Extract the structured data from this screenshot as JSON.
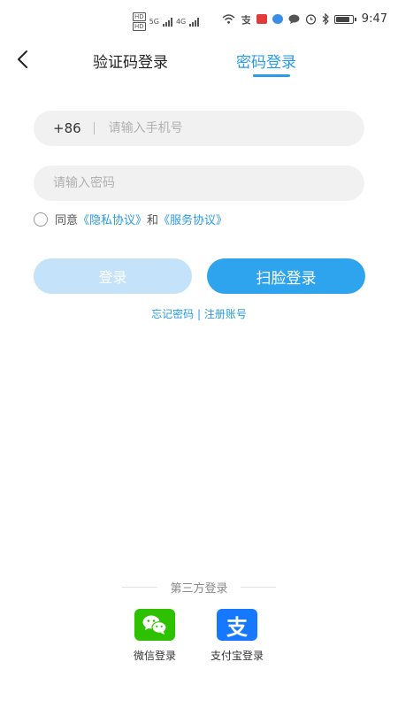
{
  "statusbar": {
    "hd1": "HD",
    "hd2": "HD",
    "net1": "5G",
    "net2": "4G",
    "time": "9:47"
  },
  "header": {
    "tab_code": "验证码登录",
    "tab_password": "密码登录"
  },
  "form": {
    "country_code": "+86",
    "phone_placeholder": "请输入手机号",
    "password_placeholder": "请输入密码",
    "agree_prefix": "同意",
    "privacy_link": "《隐私协议》",
    "and_text": "和",
    "service_link": "《服务协议》"
  },
  "buttons": {
    "login": "登录",
    "face_login": "扫脸登录"
  },
  "links": {
    "forgot": "忘记密码",
    "divider": "|",
    "register": "注册账号"
  },
  "third_party": {
    "title": "第三方登录",
    "wechat_label": "微信登录",
    "alipay_label": "支付宝登录",
    "alipay_glyph": "支"
  },
  "colors": {
    "accent": "#2b9be6",
    "login_disabled": "#c4e3fa",
    "face_button": "#2ea3ee",
    "wechat": "#2dc100",
    "alipay": "#1677ff"
  }
}
